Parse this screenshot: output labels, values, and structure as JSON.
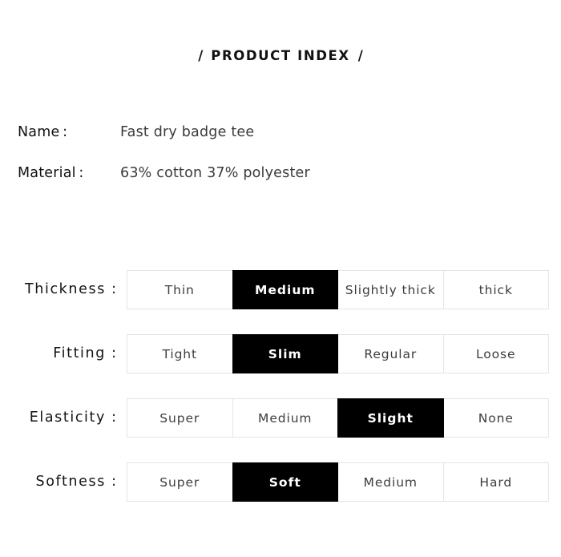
{
  "header": {
    "title": "PRODUCT INDEX",
    "ornament_left": "/",
    "ornament_right": "/"
  },
  "info": [
    {
      "label": "Name :",
      "value": "Fast dry badge tee"
    },
    {
      "label": "Material :",
      "value": "63% cotton 37% polyester"
    }
  ],
  "attributes": [
    {
      "label": "Thickness",
      "colon": ":",
      "options": [
        {
          "label": "Thin",
          "selected": false
        },
        {
          "label": "Medium",
          "selected": true
        },
        {
          "label": "Slightly thick",
          "selected": false
        },
        {
          "label": "thick",
          "selected": false
        }
      ]
    },
    {
      "label": "Fitting",
      "colon": ":",
      "options": [
        {
          "label": "Tight",
          "selected": false
        },
        {
          "label": "Slim",
          "selected": true
        },
        {
          "label": "Regular",
          "selected": false
        },
        {
          "label": "Loose",
          "selected": false
        }
      ]
    },
    {
      "label": "Elasticity",
      "colon": ":",
      "options": [
        {
          "label": "Super",
          "selected": false
        },
        {
          "label": "Medium",
          "selected": false
        },
        {
          "label": "Slight",
          "selected": true
        },
        {
          "label": "None",
          "selected": false
        }
      ]
    },
    {
      "label": "Softness",
      "colon": ":",
      "options": [
        {
          "label": "Super",
          "selected": false
        },
        {
          "label": "Soft",
          "selected": true
        },
        {
          "label": "Medium",
          "selected": false
        },
        {
          "label": "Hard",
          "selected": false
        }
      ]
    }
  ],
  "colors": {
    "background": "#ffffff",
    "selected_bg": "#000000",
    "selected_text": "#ffffff",
    "cell_border": "#e4e4e4",
    "label_text": "#131313",
    "value_text": "#3b3b3b"
  }
}
